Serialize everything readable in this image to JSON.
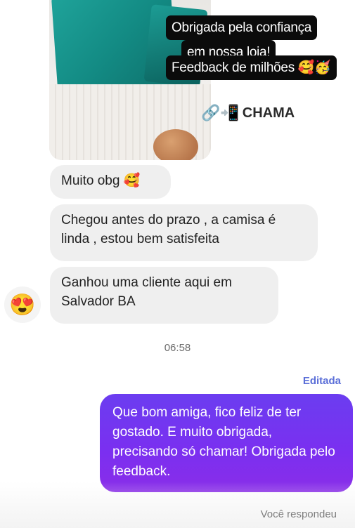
{
  "story": {
    "caption_lines": [
      "Obrigada pela confiança",
      "em nossa loja!",
      "Feedback de milhões 🥰🥳"
    ],
    "link_sticker": {
      "icons": "🔗📲",
      "label": "CHAMA"
    }
  },
  "chat": {
    "incoming": [
      {
        "text": "Muito obg 🥰"
      },
      {
        "text": "Chegou antes do prazo , a camisa é linda , estou bem satisfeita"
      },
      {
        "text": "Ganhou uma cliente aqui em Salvador BA"
      }
    ],
    "reaction_avatar": "😍",
    "timestamp": "06:58",
    "edited_label": "Editada",
    "outgoing": {
      "text": "Que bom amiga, fico feliz de ter gostado. E muito obrigada, precisando só chamar! Obrigada pelo feedback."
    },
    "footer_status": "Você respondeu"
  }
}
